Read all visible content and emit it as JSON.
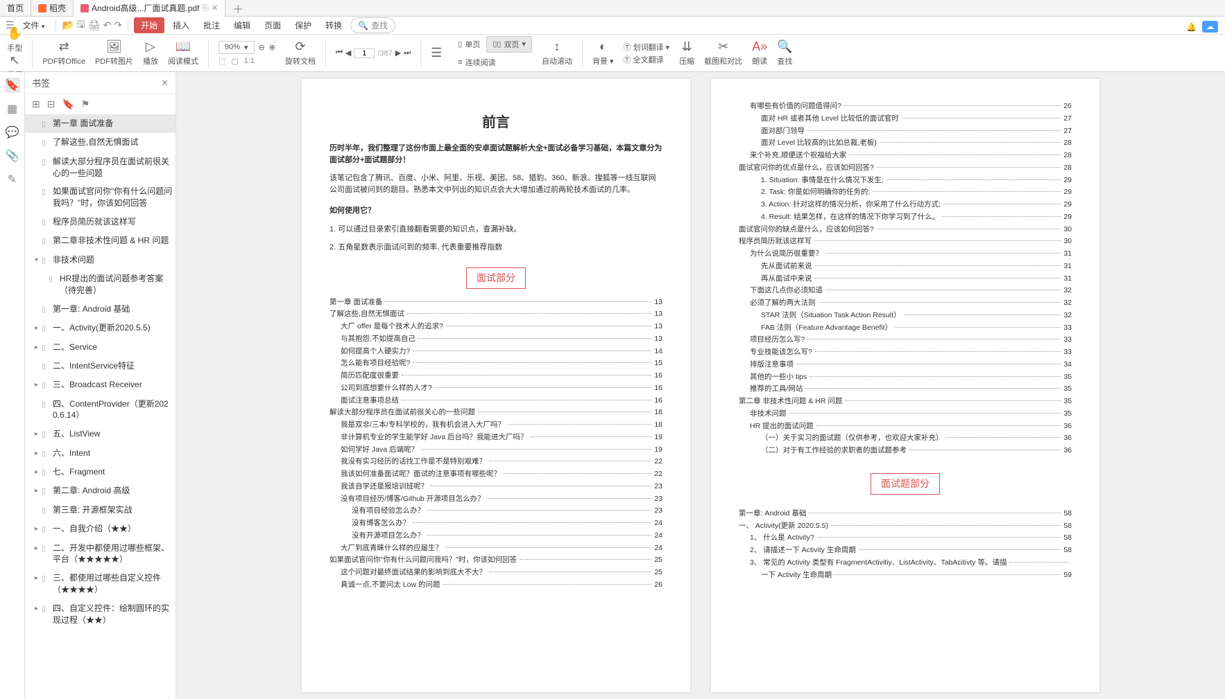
{
  "tabs": {
    "home": "首页",
    "daoke": "稻壳",
    "active": "Android高级...厂面试真题.pdf"
  },
  "menubar": {
    "file": "文件",
    "start": "开始",
    "insert": "插入",
    "approve": "批注",
    "edit": "编辑",
    "page": "页面",
    "protect": "保护",
    "convert": "转换",
    "search_placeholder": "查找"
  },
  "ribbon": {
    "hand": "手型",
    "select": "选择",
    "pdf2office": "PDF转Office",
    "pdf2img": "PDF转图片",
    "play": "播放",
    "readmode": "阅读模式",
    "zoom": "90%",
    "rotate": "旋转文档",
    "page_current": "1",
    "page_total": "/387",
    "single": "单页",
    "double": "双页",
    "continuous": "连续阅读",
    "autoscroll": "自动滚动",
    "bg": "背景",
    "wordtrans": "划词翻译",
    "fulltrans": "全文翻译",
    "compress": "压缩",
    "screenshot": "截图和对比",
    "read": "朗读",
    "find": "查找"
  },
  "sidebar": {
    "title": "书签",
    "items": [
      {
        "level": 0,
        "caret": "",
        "text": "第一章 面试准备",
        "selected": true
      },
      {
        "level": 0,
        "caret": "",
        "text": "了解这些,自然无惧面试"
      },
      {
        "level": 0,
        "caret": "",
        "text": "解读大部分程序员在面试前很关心的一些问题"
      },
      {
        "level": 0,
        "caret": "",
        "text": "如果面试官问你\"你有什么问题问我吗？\"时，你该如何回答"
      },
      {
        "level": 0,
        "caret": "",
        "text": "程序员简历就该这样写"
      },
      {
        "level": 0,
        "caret": "",
        "text": "第二章非技术性问题 & HR 问题"
      },
      {
        "level": 0,
        "caret": "▾",
        "text": "非技术问题"
      },
      {
        "level": 1,
        "caret": "",
        "text": "HR提出的面试问题参考答案（待完善）"
      },
      {
        "level": 0,
        "caret": "",
        "text": "第一章: Android 基础"
      },
      {
        "level": 0,
        "caret": "▸",
        "text": "一、Activity(更新2020.5.5)"
      },
      {
        "level": 0,
        "caret": "▸",
        "text": "二、Service"
      },
      {
        "level": 0,
        "caret": "",
        "text": "二、IntentService特征"
      },
      {
        "level": 0,
        "caret": "▸",
        "text": "三、Broadcast Receiver"
      },
      {
        "level": 0,
        "caret": "",
        "text": "四、ContentProvider（更新2020.6.14）"
      },
      {
        "level": 0,
        "caret": "▸",
        "text": "五、ListView"
      },
      {
        "level": 0,
        "caret": "▸",
        "text": "六、Intent"
      },
      {
        "level": 0,
        "caret": "▸",
        "text": "七、Fragment"
      },
      {
        "level": 0,
        "caret": "▸",
        "text": "第二章: Android 高级"
      },
      {
        "level": 0,
        "caret": "",
        "text": "第三章: 开源框架实战"
      },
      {
        "level": 0,
        "caret": "▸",
        "text": "一、自我介绍（★★）"
      },
      {
        "level": 0,
        "caret": "▸",
        "text": "二、开发中都使用过哪些框架、平台（★★★★★）"
      },
      {
        "level": 0,
        "caret": "▸",
        "text": "三、都使用过哪些自定义控件（★★★★）"
      },
      {
        "level": 0,
        "caret": "▸",
        "text": "四、自定义控件：绘制圆环的实现过程（★★）"
      }
    ]
  },
  "page1": {
    "title": "前言",
    "intro1": "历时半年，我们整理了这份市面上最全面的安卓面试题解析大全+面试必备学习基础，本篇文章分为面试部分+面试题部分！",
    "intro2": "该笔记包含了腾讯、百度、小米、阿里、乐视、美团、58、猎豹、360、新浪、搜狐等一线互联网公司面试被问到的题目。熟悉本文中列出的知识点会大大增加通过前两轮技术面试的几率。",
    "how_title": "如何使用它？",
    "how1": "1. 可以通过目录索引直接翻看需要的知识点，查漏补缺。",
    "how2": "2. 五角星数表示面试问到的频率, 代表重要推荐指数",
    "section_label": "面试部分",
    "toc": [
      {
        "ind": 0,
        "t": "第一章 面试准备",
        "p": "13"
      },
      {
        "ind": 0,
        "t": "了解这些,自然无惧面试",
        "p": "13"
      },
      {
        "ind": 1,
        "t": "大厂 offer 是每个技术人的追求?",
        "p": "13"
      },
      {
        "ind": 1,
        "t": "与其抱怨,不如提高自己",
        "p": "13"
      },
      {
        "ind": 1,
        "t": "如何提高个人硬实力?",
        "p": "14"
      },
      {
        "ind": 1,
        "t": "怎么能有项目经验呢?",
        "p": "15"
      },
      {
        "ind": 1,
        "t": "简历匹配度很重要",
        "p": "16"
      },
      {
        "ind": 1,
        "t": "公司到底想要什么样的人才?",
        "p": "16"
      },
      {
        "ind": 1,
        "t": "面试注意事项总结",
        "p": "16"
      },
      {
        "ind": 0,
        "t": "解读大部分程序员在面试前很关心的一些问题",
        "p": "18"
      },
      {
        "ind": 1,
        "t": "我是双非/三本/专科学校的，我有机会进入大厂吗？",
        "p": "18"
      },
      {
        "ind": 1,
        "t": "非计算机专业的学生能学好 Java 后台吗？我能进大厂吗？",
        "p": "19"
      },
      {
        "ind": 1,
        "t": "如何学好 Java 后端呢？",
        "p": "19"
      },
      {
        "ind": 1,
        "t": "我没有实习经历的话找工作是不是特别艰难？",
        "p": "22"
      },
      {
        "ind": 1,
        "t": "我该如何准备面试呢？面试的注意事项有哪些呢？",
        "p": "22"
      },
      {
        "ind": 1,
        "t": "我该自学还是报培训班呢？",
        "p": "23"
      },
      {
        "ind": 1,
        "t": "没有项目经历/博客/Github 开源项目怎么办？",
        "p": "23"
      },
      {
        "ind": 2,
        "t": "没有项目经验怎么办？",
        "p": "23"
      },
      {
        "ind": 2,
        "t": "没有博客怎么办？",
        "p": "24"
      },
      {
        "ind": 2,
        "t": "没有开源项目怎么办？",
        "p": "24"
      },
      {
        "ind": 1,
        "t": "大厂到底青睐什么样的应届生？",
        "p": "24"
      },
      {
        "ind": 0,
        "t": "如果面试官问你\"你有什么问题问我吗？\"时，你该如何回答",
        "p": "25"
      },
      {
        "ind": 1,
        "t": "这个问题对最终面试结果的影响到底大不大？",
        "p": "25"
      },
      {
        "ind": 1,
        "t": "真诚一点,不要问太 Low 的问题",
        "p": "26"
      }
    ]
  },
  "page2": {
    "section_label": "面试题部分",
    "toc_top": [
      {
        "ind": 1,
        "t": "有哪些有价值的问题值得问?",
        "p": "26"
      },
      {
        "ind": 2,
        "t": "面对 HR 或者其他 Level 比较低的面试官时",
        "p": "27"
      },
      {
        "ind": 2,
        "t": "面对部门领导",
        "p": "27"
      },
      {
        "ind": 2,
        "t": "面对 Level 比较高的(比如总裁,老板)",
        "p": "28"
      },
      {
        "ind": 1,
        "t": "来个补充,顺便送个祝福给大家",
        "p": "28"
      },
      {
        "ind": 0,
        "t": "面试官问你的优点是什么，应该如何回答?",
        "p": "28"
      },
      {
        "ind": 2,
        "t": "1. Situation:     事情是在什么情况下发生;",
        "p": "29"
      },
      {
        "ind": 2,
        "t": "2. Task:     你是如何明确你的任务的;",
        "p": "29"
      },
      {
        "ind": 2,
        "t": "3. Action:     针对这样的情况分析，你采用了什么行动方式;",
        "p": "29"
      },
      {
        "ind": 2,
        "t": "4. Result:     结果怎样，在这样的情况下你学习到了什么。",
        "p": "29"
      },
      {
        "ind": 0,
        "t": "面试官问你的缺点是什么，应该如何回答?",
        "p": "30"
      },
      {
        "ind": 0,
        "t": "程序员简历就该这样写",
        "p": "30"
      },
      {
        "ind": 1,
        "t": "为什么说简历很重要？",
        "p": "31"
      },
      {
        "ind": 2,
        "t": "先从面试前来说",
        "p": "31"
      },
      {
        "ind": 2,
        "t": "再从面试中来说",
        "p": "31"
      },
      {
        "ind": 1,
        "t": "下面这几点你必须知道",
        "p": "32"
      },
      {
        "ind": 1,
        "t": "必须了解的两大法则",
        "p": "32"
      },
      {
        "ind": 2,
        "t": "STAR 法则（Situation Task Action Result）",
        "p": "32"
      },
      {
        "ind": 2,
        "t": "FAB 法则（Feature Advantage Benefit）",
        "p": "33"
      },
      {
        "ind": 1,
        "t": "项目经历怎么写?",
        "p": "33"
      },
      {
        "ind": 1,
        "t": "专业技能该怎么写?",
        "p": "33"
      },
      {
        "ind": 1,
        "t": "排版注意事项",
        "p": "34"
      },
      {
        "ind": 1,
        "t": "其他的一些小 tips",
        "p": "35"
      },
      {
        "ind": 1,
        "t": "推荐的工具/网站",
        "p": "35"
      },
      {
        "ind": 0,
        "t": "第二章 非技术性问题 & HR 问题",
        "p": "35"
      },
      {
        "ind": 1,
        "t": "非技术问题",
        "p": "35"
      },
      {
        "ind": 1,
        "t": "HR 提出的面试问题",
        "p": "36"
      },
      {
        "ind": 2,
        "t": "（一）关于实习的面试题（仅供参考，也欢迎大家补充）",
        "p": "36"
      },
      {
        "ind": 2,
        "t": "（二）对于有工作经验的求职者的面试题参考",
        "p": "36"
      }
    ],
    "toc_bottom": [
      {
        "ind": 0,
        "t": "第一章: Android 基础",
        "p": "58"
      },
      {
        "ind": 0,
        "t": "一、 Activity(更新 2020.5.5)",
        "p": "58"
      },
      {
        "ind": 1,
        "t": "1、 什么是 Activity?",
        "p": "58"
      },
      {
        "ind": 1,
        "t": "2、 请描述一下 Activity 生命周期",
        "p": "58"
      },
      {
        "ind": 1,
        "t": "3、 常见的 Activity 类型有 FragmentActivitiy、ListActivity、TabAcitivty 等。请描",
        "p": ""
      },
      {
        "ind": 2,
        "t": "一下 Activity 生命周期",
        "p": "59"
      }
    ]
  }
}
